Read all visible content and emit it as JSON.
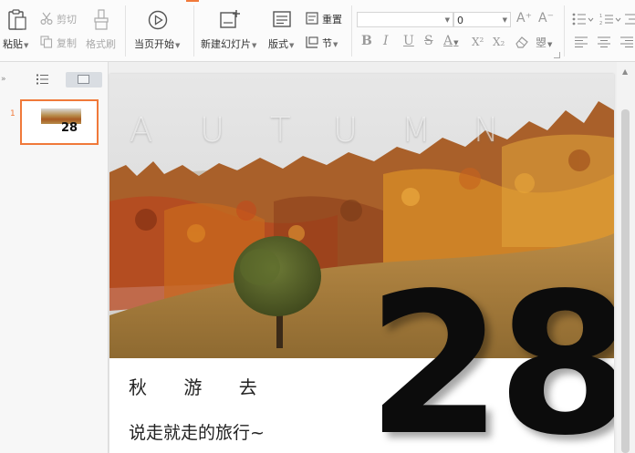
{
  "ribbon": {
    "clipboard": {
      "paste_label": "粘贴",
      "cut_label": "剪切",
      "copy_label": "复制",
      "format_painter_label": "格式刷"
    },
    "slideshow": {
      "from_current_label": "当页开始"
    },
    "slides": {
      "new_slide_label": "新建幻灯片",
      "layout_label": "版式",
      "reset_label": "重置",
      "section_label": "节"
    },
    "font": {
      "font_name_value": "",
      "font_size_value": "0",
      "grow_glyph": "A⁺",
      "shrink_glyph": "A⁻",
      "bold_glyph": "B",
      "italic_glyph": "I",
      "underline_glyph": "U",
      "strike_glyph": "S",
      "color_glyph": "A",
      "superscript_glyph": "X²",
      "subscript_glyph": "X₂",
      "phonetic_glyph": "曌"
    }
  },
  "left_panel": {
    "slide_number": "1",
    "thumbnail_number": "28"
  },
  "slide": {
    "title_letters": [
      "A",
      "U",
      "T",
      "U",
      "M",
      "N"
    ],
    "big_number": "28",
    "subtitle_1": "秋 游 去",
    "subtitle_2": "说走就走的旅行~"
  },
  "colors": {
    "accent": "#f0793a",
    "number": "#0c0c0c"
  }
}
